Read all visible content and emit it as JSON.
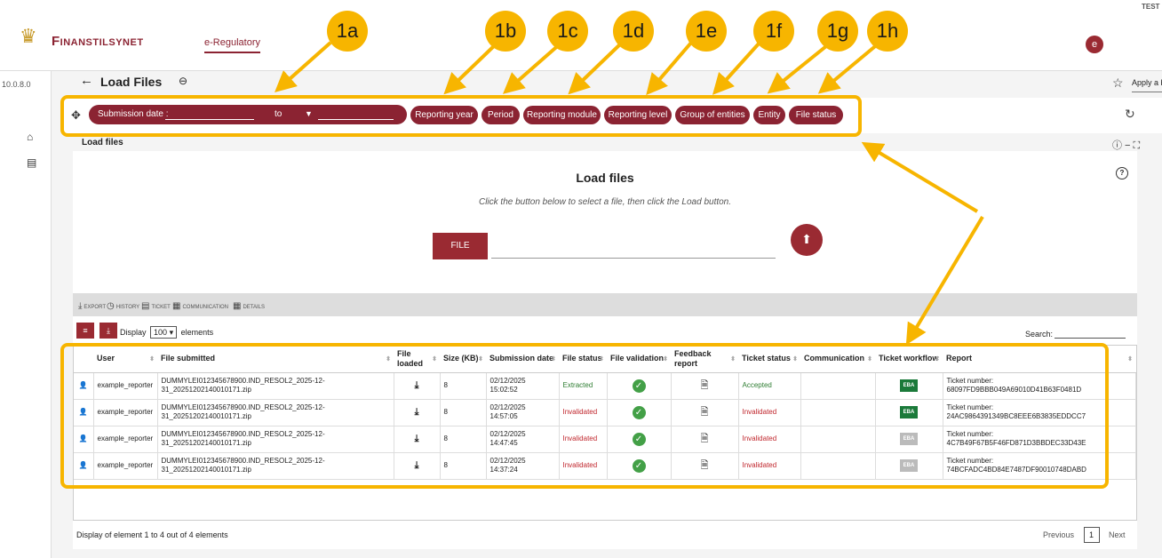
{
  "app": {
    "brand": "Finanstilsynet",
    "tab": "e-Regulatory",
    "avatar": "e",
    "test_label": "TEST",
    "version": "10.0.8.0"
  },
  "page": {
    "title": "Load Files",
    "bookmark_placeholder": "Apply a bookmarked filter"
  },
  "filters": {
    "submission_label": "Submission date :",
    "to_label": "to",
    "chips": [
      "Reporting year",
      "Period",
      "Reporting module",
      "Reporting level",
      "Group of entities",
      "Entity",
      "File status"
    ]
  },
  "panel": {
    "label": "Load files",
    "title": "Load files",
    "subtitle": "Click the button below to select a file, then click the Load button.",
    "file_button": "FILE"
  },
  "actions": [
    "EXPORT",
    "HISTORY",
    "TICKET",
    "COMMUNICATION",
    "DETAILS"
  ],
  "table_tools": {
    "display": "Display",
    "page_size": "100",
    "elements": "elements",
    "search_label": "Search:"
  },
  "columns": [
    "User",
    "File submitted",
    "File loaded",
    "Size (KB)",
    "Submission date",
    "File status",
    "File validation",
    "Feedback report",
    "Ticket status",
    "Communication",
    "Ticket workflow",
    "Report"
  ],
  "rows": [
    {
      "user": "example_reporter",
      "file": "DUMMYLEI012345678900.IND_RESOL2_2025-12-31_20251202140010171.zip",
      "size": "8",
      "date": "02/12/2025 15:02:52",
      "file_status": "Extracted",
      "ticket_status": "Accepted",
      "eba": "EBA",
      "report_label": "Ticket number:",
      "ticket": "68097FD9BBB049A69010D41B63F0481D"
    },
    {
      "user": "example_reporter",
      "file": "DUMMYLEI012345678900.IND_RESOL2_2025-12-31_20251202140010171.zip",
      "size": "8",
      "date": "02/12/2025 14:57:05",
      "file_status": "Invalidated",
      "ticket_status": "Invalidated",
      "eba": "EBA",
      "report_label": "Ticket number:",
      "ticket": "24AC9864391349BC8EEE6B3835EDDCC7"
    },
    {
      "user": "example_reporter",
      "file": "DUMMYLEI012345678900.IND_RESOL2_2025-12-31_20251202140010171.zip",
      "size": "8",
      "date": "02/12/2025 14:47:45",
      "file_status": "Invalidated",
      "ticket_status": "Invalidated",
      "eba": "EBA",
      "report_label": "Ticket number:",
      "ticket": "4C7B49F67B5F46FD871D3BBDEC33D43E"
    },
    {
      "user": "example_reporter",
      "file": "DUMMYLEI012345678900.IND_RESOL2_2025-12-31_20251202140010171.zip",
      "size": "8",
      "date": "02/12/2025 14:37:24",
      "file_status": "Invalidated",
      "ticket_status": "Invalidated",
      "eba": "EBA",
      "report_label": "Ticket number:",
      "ticket": "74BCFADC4BD84E7487DF90010748DABD"
    }
  ],
  "footer": {
    "summary": "Display of element 1 to 4 out of 4 elements",
    "previous": "Previous",
    "page": "1",
    "next": "Next"
  },
  "markers": [
    "1a",
    "1b",
    "1c",
    "1d",
    "1e",
    "1f",
    "1g",
    "1h"
  ],
  "colors": {
    "brand": "#8b2332",
    "highlight": "#f7b500",
    "valid": "#43a047",
    "eba_active": "#1b7a3a"
  },
  "icons": [
    "crown-icon",
    "back-arrow-icon",
    "link-icon",
    "star-icon",
    "help-icon",
    "move-icon",
    "refresh-icon",
    "home-icon",
    "chat-icon",
    "upload-icon",
    "download-icon",
    "user-icon",
    "check-icon",
    "feedback-icon"
  ]
}
